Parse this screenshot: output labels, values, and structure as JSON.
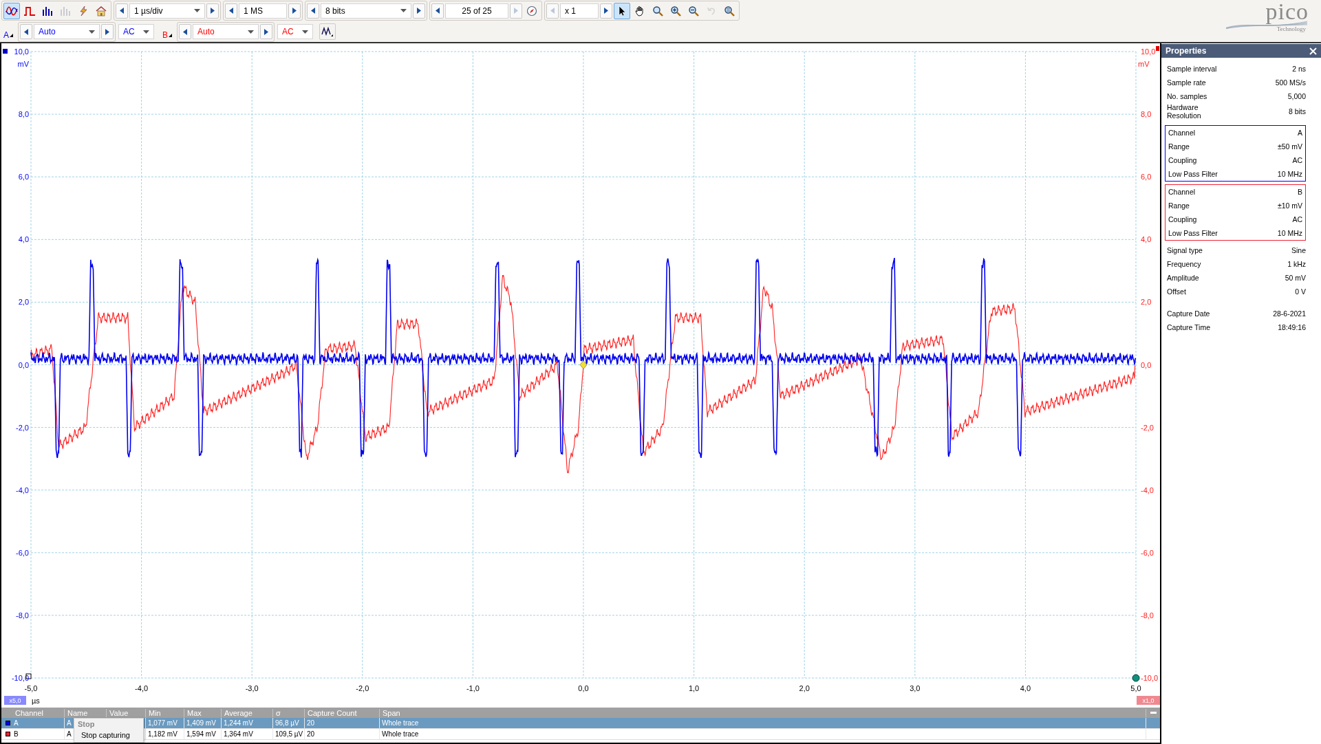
{
  "toolbar": {
    "modes": [
      {
        "kind": "scope",
        "selected": true,
        "disabled": false
      },
      {
        "kind": "persistence",
        "selected": false,
        "disabled": false
      },
      {
        "kind": "spectrum",
        "selected": false,
        "disabled": false
      },
      {
        "kind": "spectrum",
        "selected": false,
        "disabled": true
      }
    ],
    "actions": [
      {
        "kind": "autosetup"
      },
      {
        "kind": "home"
      }
    ],
    "spinners": [
      {
        "kind": "timebase",
        "value": "1 µs/div",
        "dropdown": true,
        "prev_disabled": false,
        "next_disabled": false
      },
      {
        "kind": "samples",
        "value": "1 MS",
        "dropdown": false,
        "prev_disabled": false,
        "next_disabled": false
      },
      {
        "kind": "resolution",
        "value": "8 bits",
        "dropdown": true,
        "prev_disabled": false,
        "next_disabled": false
      },
      {
        "kind": "buffer",
        "value": "25 of 25",
        "dropdown": false,
        "prev_disabled": false,
        "next_disabled": true
      },
      {
        "kind": "zoom",
        "value": "x 1",
        "dropdown": false,
        "prev_disabled": true,
        "next_disabled": false
      }
    ],
    "view_tools": [
      {
        "kind": "pointer",
        "selected": true,
        "disabled": false
      },
      {
        "kind": "hand",
        "selected": false,
        "disabled": false
      },
      {
        "kind": "zoom-area",
        "selected": false,
        "disabled": false
      },
      {
        "kind": "zoom-in",
        "selected": false,
        "disabled": false
      },
      {
        "kind": "zoom-out",
        "selected": false,
        "disabled": false
      },
      {
        "kind": "undo",
        "selected": false,
        "disabled": true
      },
      {
        "kind": "zoom-fit",
        "selected": false,
        "disabled": false
      }
    ]
  },
  "channels": [
    {
      "label": "A",
      "range": "Auto",
      "coupling": "AC",
      "color": "#0000ff"
    },
    {
      "label": "B",
      "range": "Auto",
      "coupling": "AC",
      "color": "#ff0000"
    }
  ],
  "logo": {
    "name": "pico",
    "tagline": "Technology"
  },
  "graph": {
    "left_unit": "mV",
    "right_unit": "mV",
    "x_unit": "µs",
    "left_scale": "x5,0",
    "right_scale": "x1,0",
    "left_ticks": [
      "10,0",
      "8,0",
      "6,0",
      "4,0",
      "2,0",
      "0,0",
      "-2,0",
      "-4,0",
      "-6,0",
      "-8,0",
      "-10,0"
    ],
    "right_ticks": [
      "10,0",
      "8,0",
      "6,0",
      "4,0",
      "2,0",
      "0,0",
      "-2,0",
      "-4,0",
      "-6,0",
      "-8,0",
      "-10,0"
    ],
    "x_ticks": [
      "-5,0",
      "-4,0",
      "-3,0",
      "-2,0",
      "-1,0",
      "0,0",
      "1,0",
      "2,0",
      "3,0",
      "4,0",
      "5,0"
    ]
  },
  "properties": {
    "title": "Properties",
    "general": [
      {
        "label": "Sample interval",
        "value": "2 ns"
      },
      {
        "label": "Sample rate",
        "value": "500 MS/s"
      },
      {
        "label": "No. samples",
        "value": "5,000"
      },
      {
        "label": "Hardware Resolution",
        "value": "8 bits"
      }
    ],
    "channel_groups": [
      {
        "color": "#0000ff",
        "rows": [
          {
            "label": "Channel",
            "value": "A"
          },
          {
            "label": "Range",
            "value": "±50 mV"
          },
          {
            "label": "Coupling",
            "value": "AC"
          },
          {
            "label": "Low Pass Filter",
            "value": "10 MHz"
          }
        ]
      },
      {
        "color": "#ee2233",
        "rows": [
          {
            "label": "Channel",
            "value": "B"
          },
          {
            "label": "Range",
            "value": "±10 mV"
          },
          {
            "label": "Coupling",
            "value": "AC"
          },
          {
            "label": "Low Pass Filter",
            "value": "10 MHz"
          }
        ]
      }
    ],
    "signal": [
      {
        "label": "Signal type",
        "value": "Sine"
      },
      {
        "label": "Frequency",
        "value": "1 kHz"
      },
      {
        "label": "Amplitude",
        "value": "50 mV"
      },
      {
        "label": "Offset",
        "value": "0 V"
      }
    ],
    "capture": [
      {
        "label": "Capture Date",
        "value": "28-6-2021"
      },
      {
        "label": "Capture Time",
        "value": "18:49:16"
      }
    ]
  },
  "measurements": {
    "columns": [
      "Channel",
      "Name",
      "Value",
      "Min",
      "Max",
      "Average",
      "σ",
      "Capture Count",
      "Span"
    ],
    "rows": [
      {
        "channel": "A",
        "color": "#0000ff",
        "name": "A",
        "min": "1,077 mV",
        "max": "1,409 mV",
        "average": "1,244 mV",
        "sigma": "96,8 µV",
        "count": "20",
        "span": "Whole trace",
        "selected": true
      },
      {
        "channel": "B",
        "color": "#ee2233",
        "name": "A",
        "min": "1,182 mV",
        "max": "1,594 mV",
        "average": "1,364 mV",
        "sigma": "109,5 µV",
        "count": "20",
        "span": "Whole trace",
        "selected": false
      }
    ]
  },
  "context_menu": {
    "title": "Stop",
    "item": "Stop capturing"
  }
}
